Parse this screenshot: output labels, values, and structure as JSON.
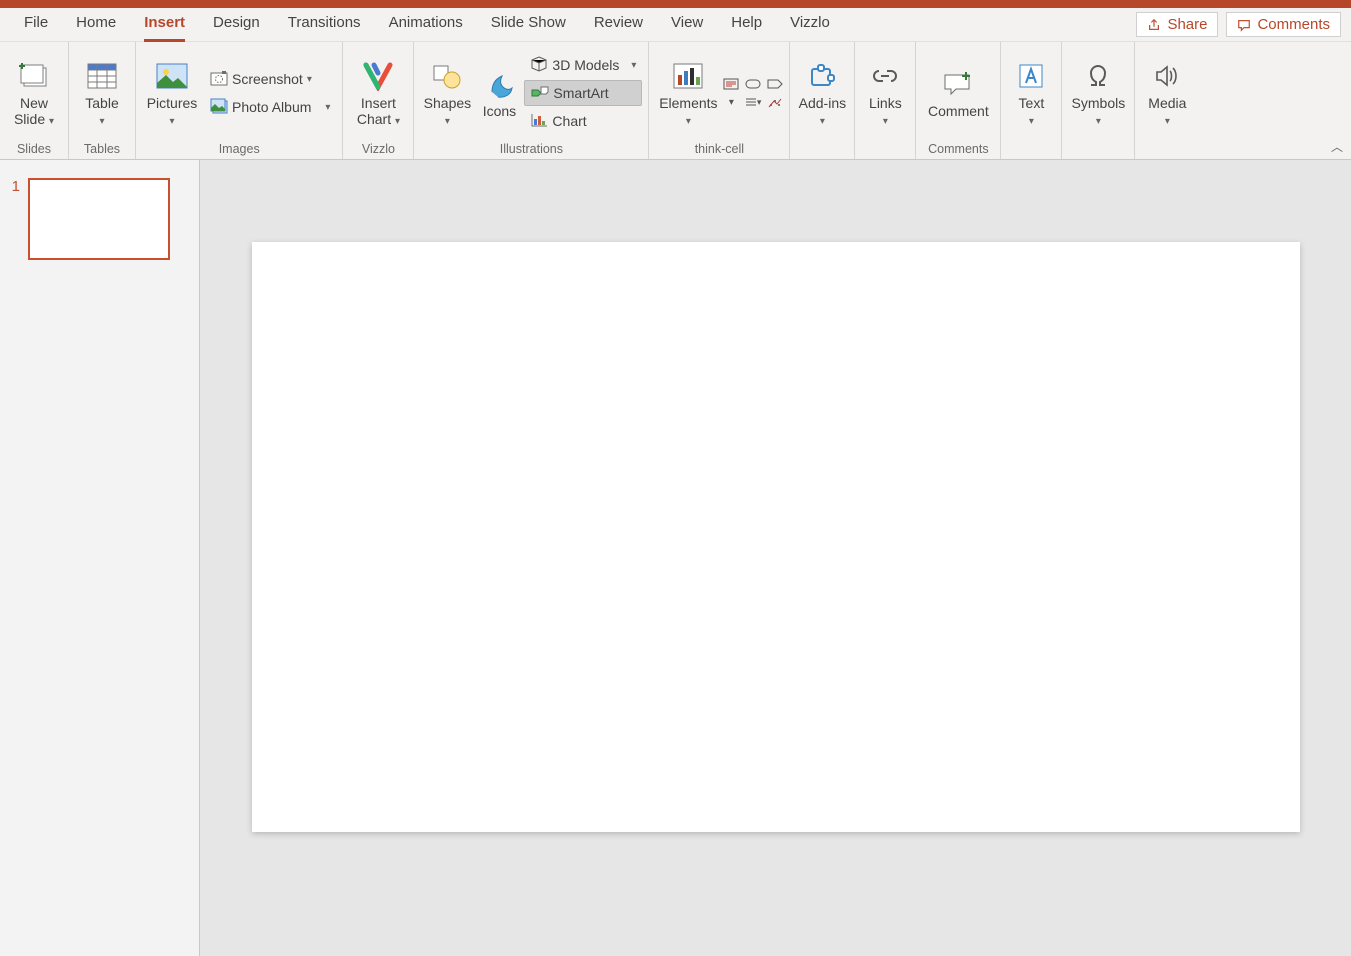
{
  "tabs": {
    "file": "File",
    "home": "Home",
    "insert": "Insert",
    "design": "Design",
    "transitions": "Transitions",
    "animations": "Animations",
    "slideshow": "Slide Show",
    "review": "Review",
    "view": "View",
    "help": "Help",
    "vizzlo": "Vizzlo",
    "active": "insert"
  },
  "topRight": {
    "share": "Share",
    "comments": "Comments"
  },
  "ribbon": {
    "slides": {
      "group": "Slides",
      "newSlide": "New Slide"
    },
    "tables": {
      "group": "Tables",
      "table": "Table"
    },
    "images": {
      "group": "Images",
      "pictures": "Pictures",
      "screenshot": "Screenshot",
      "photoAlbum": "Photo Album"
    },
    "vizzlo": {
      "group": "Vizzlo",
      "insertChart": "Insert Chart"
    },
    "illustrations": {
      "group": "Illustrations",
      "shapes": "Shapes",
      "icons": "Icons",
      "models3d": "3D Models",
      "smartArt": "SmartArt",
      "chart": "Chart"
    },
    "thinkCell": {
      "group": "think-cell",
      "elements": "Elements"
    },
    "addIns": {
      "group": "",
      "label": "Add-ins"
    },
    "links": {
      "group": "",
      "label": "Links"
    },
    "comments": {
      "group": "Comments",
      "comment": "Comment"
    },
    "text": {
      "group": "",
      "label": "Text"
    },
    "symbols": {
      "group": "",
      "label": "Symbols"
    },
    "media": {
      "group": "",
      "label": "Media"
    }
  },
  "slidePanel": {
    "slides": [
      {
        "number": "1"
      }
    ]
  }
}
